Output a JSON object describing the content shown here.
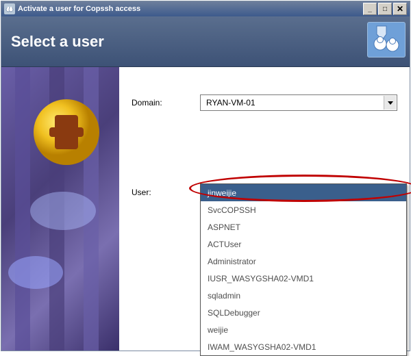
{
  "window": {
    "title": "Activate a user for Copssh access"
  },
  "header": {
    "title": "Select a user"
  },
  "form": {
    "domain_label": "Domain:",
    "user_label": "User:",
    "domain_value": "RYAN-VM-01"
  },
  "user_dropdown": {
    "selected": "jinweijie",
    "items": [
      "jinweijie",
      "SvcCOPSSH",
      "ASPNET",
      "ACTUser",
      "Administrator",
      "IUSR_WASYGSHA02-VMD1",
      "sqladmin",
      "SQLDebugger",
      "weijie",
      "IWAM_WASYGSHA02-VMD1"
    ]
  }
}
